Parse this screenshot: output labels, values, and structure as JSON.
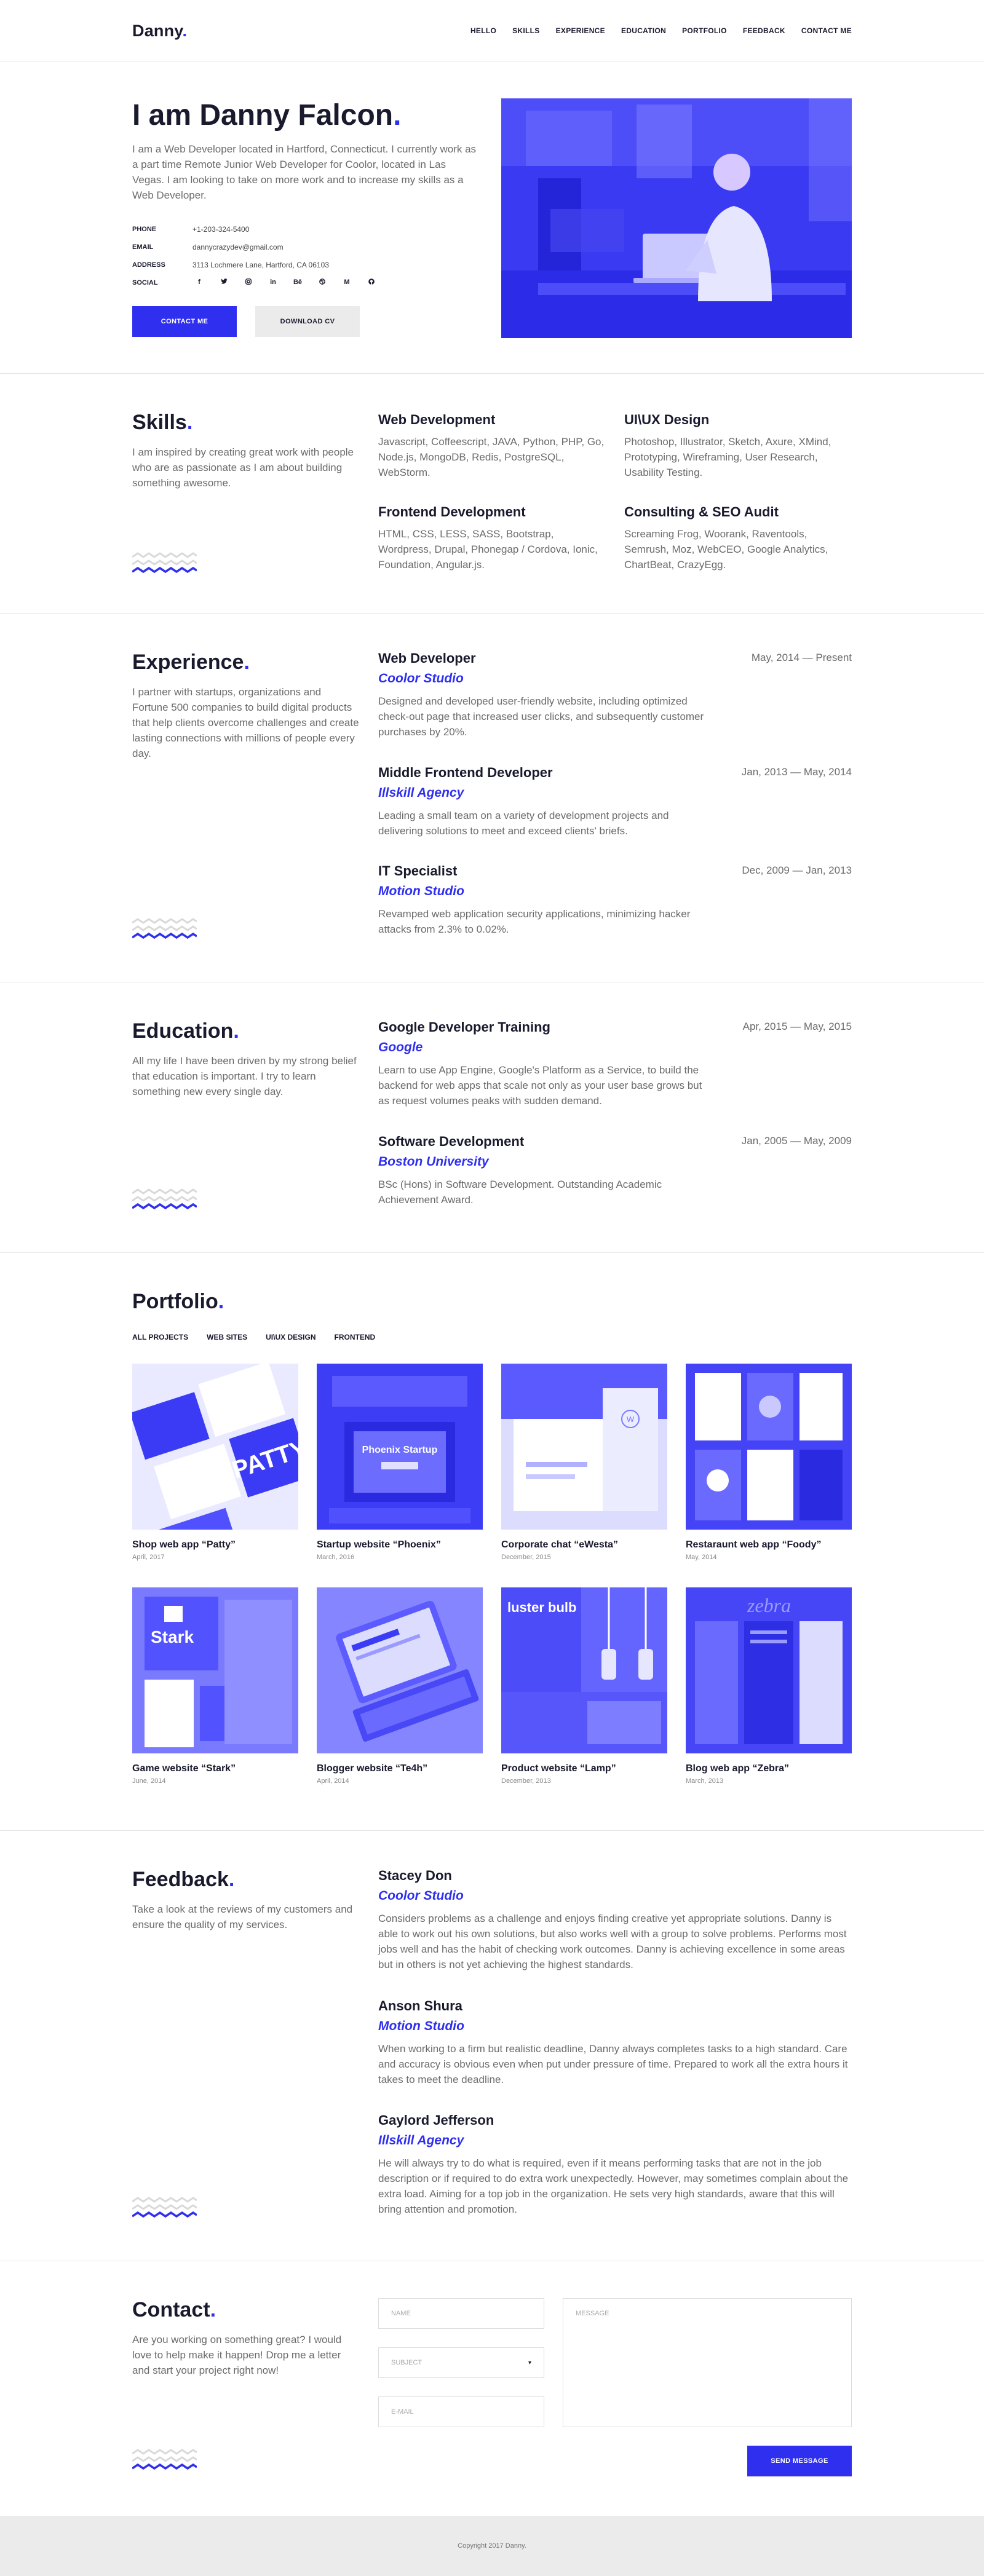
{
  "header": {
    "logo": "Danny",
    "logo_dot": ".",
    "nav": [
      "HELLO",
      "SKILLS",
      "EXPERIENCE",
      "EDUCATION",
      "PORTFOLIO",
      "FEEDBACK",
      "CONTACT ME"
    ]
  },
  "hero": {
    "title": "I am Danny Falcon",
    "title_dot": ".",
    "intro": "I am a Web Developer located in Hartford, Connecticut. I currently work as a part time Remote Junior Web Developer for Coolor, located in Las Vegas. I am looking to take on more work and to increase my skills as a Web Developer.",
    "phone_label": "PHONE",
    "phone": "+1-203-324-5400",
    "email_label": "EMAIL",
    "email": "dannycrazydev@gmail.com",
    "address_label": "ADDRESS",
    "address": "3113 Lochmere Lane, Hartford, CA 06103",
    "social_label": "SOCIAL",
    "socials": [
      "f",
      "t",
      "ig",
      "in",
      "be",
      "dr",
      "m",
      "gh"
    ],
    "contact_btn": "CONTACT ME",
    "cv_btn": "DOWNLOAD CV"
  },
  "skills": {
    "title": "Skills",
    "desc": "I am inspired by creating great work with people who are as passionate as I am about building something awesome.",
    "items": [
      {
        "title": "Web Development",
        "text": "Javascript, Coffeescript, JAVA, Python, PHP, Go, Node.js, MongoDB, Redis, PostgreSQL, WebStorm."
      },
      {
        "title": "UI\\UX Design",
        "text": "Photoshop, Illustrator, Sketch, Axure, XMind, Prototyping, Wireframing, User Research, Usability Testing."
      },
      {
        "title": "Frontend Development",
        "text": "HTML, CSS, LESS, SASS, Bootstrap, Wordpress, Drupal, Phonegap / Cordova, Ionic, Foundation, Angular.js."
      },
      {
        "title": "Consulting & SEO Audit",
        "text": "Screaming Frog, Woorank, Raventools, Semrush, Moz, WebCEO, Google Analytics, ChartBeat, CrazyEgg."
      }
    ]
  },
  "experience": {
    "title": "Experience",
    "desc": "I partner with startups, organizations and Fortune 500 companies to build digital products that help clients overcome challenges and create lasting connections with millions of people every day.",
    "items": [
      {
        "role": "Web Developer",
        "company": "Coolor Studio",
        "date": "May, 2014 — Present",
        "text": "Designed and developed user-friendly website, including optimized check-out page that increased user clicks, and subsequently customer purchases by 20%."
      },
      {
        "role": "Middle Frontend Developer",
        "company": "Illskill Agency",
        "date": "Jan, 2013 — May, 2014",
        "text": "Leading a small team on a variety of development projects and delivering solutions to meet and exceed clients' briefs."
      },
      {
        "role": "IT Specialist",
        "company": "Motion Studio",
        "date": "Dec, 2009 — Jan, 2013",
        "text": "Revamped web application security applications, minimizing hacker attacks from 2.3% to 0.02%."
      }
    ]
  },
  "education": {
    "title": "Education",
    "desc": "All my life I have been driven by my strong belief that education is important. I try to learn something new every single day.",
    "items": [
      {
        "role": "Google Developer Training",
        "company": "Google",
        "date": "Apr, 2015 — May, 2015",
        "text": "Learn to use App Engine, Google's Platform as a Service, to build the backend for web apps that scale not only as your user base grows but as request volumes peaks with sudden demand."
      },
      {
        "role": "Software Development",
        "company": "Boston University",
        "date": "Jan, 2005 — May, 2009",
        "text": "BSc (Hons) in Software Development. Outstanding Academic Achievement Award."
      }
    ]
  },
  "portfolio": {
    "title": "Portfolio",
    "filters": [
      "ALL PROJECTS",
      "WEB SITES",
      "UI\\UX DESIGN",
      "FRONTEND"
    ],
    "items": [
      {
        "title": "Shop web app “Patty”",
        "date": "April, 2017",
        "img_text": "PATTY"
      },
      {
        "title": "Startup website “Phoenix”",
        "date": "March, 2016",
        "img_text": "Phoenix Startup"
      },
      {
        "title": "Corporate chat “eWesta”",
        "date": "December, 2015",
        "img_text": "W"
      },
      {
        "title": "Restaraunt web app “Foody”",
        "date": "May, 2014",
        "img_text": ""
      },
      {
        "title": "Game website “Stark”",
        "date": "June, 2014",
        "img_text": "Stark"
      },
      {
        "title": "Blogger website “Te4h”",
        "date": "April, 2014",
        "img_text": ""
      },
      {
        "title": "Product website “Lamp”",
        "date": "December, 2013",
        "img_text": "luster bulb"
      },
      {
        "title": "Blog web app “Zebra”",
        "date": "March, 2013",
        "img_text": "zebra"
      }
    ]
  },
  "feedback": {
    "title": "Feedback",
    "desc": "Take a look at the reviews of my customers and ensure the quality of my services.",
    "items": [
      {
        "name": "Stacey Don",
        "company": "Coolor Studio",
        "text": "Considers problems as a challenge and enjoys finding creative yet appropriate solutions. Danny is able to work out his own solutions, but also works well with a group to solve problems. Performs most jobs well and has the habit of checking work outcomes. Danny is achieving excellence in some areas but in others is not yet achieving the highest standards."
      },
      {
        "name": "Anson Shura",
        "company": "Motion Studio",
        "text": "When working to a firm but realistic deadline, Danny always completes tasks to a high standard. Care and accuracy is obvious even when put under pressure of time. Prepared to work all the extra hours it takes to meet the deadline."
      },
      {
        "name": "Gaylord Jefferson",
        "company": "Illskill Agency",
        "text": "He will always try to do what is required, even if it means performing tasks that are not in the job description or if required to do extra work unexpectedly. However, may sometimes complain about the extra load. Aiming for a top job in the organization. He sets very high standards, aware that this will bring attention and promotion."
      }
    ]
  },
  "contact": {
    "title": "Contact",
    "desc": "Are you working on something great? I would love to help make it happen! Drop me a letter and start your project right now!",
    "name_ph": "NAME",
    "subject_ph": "SUBJECT",
    "email_ph": "E-MAIL",
    "message_ph": "MESSAGE",
    "send_btn": "SEND MESSAGE"
  },
  "footer": {
    "copyright": "Copyright 2017 Danny."
  },
  "colors": {
    "accent": "#2f2ff0",
    "dark": "#1a1a2e",
    "muted": "#6b6b6b",
    "footer_bg": "#ebebeb"
  }
}
